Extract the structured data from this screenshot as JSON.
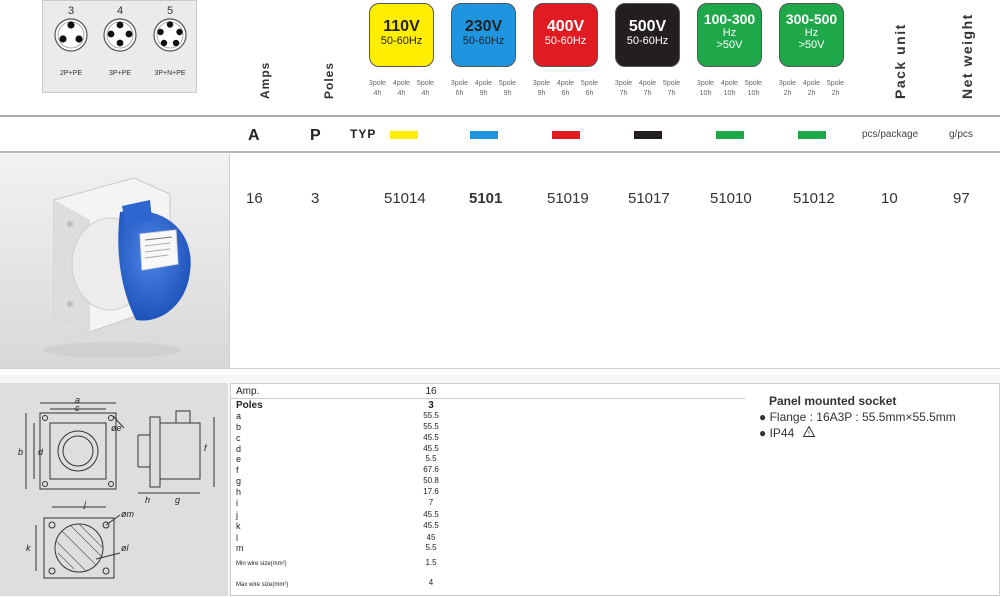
{
  "pin_configs": [
    {
      "number": "3",
      "label": "2P+PE",
      "pins": 3
    },
    {
      "number": "4",
      "label": "3P+PE",
      "pins": 4
    },
    {
      "number": "5",
      "label": "3P+N+PE",
      "pins": 5
    }
  ],
  "column_headers": {
    "amps": "Amps",
    "poles": "Poles",
    "pack_unit": "Pack unit",
    "net_weight": "Net weight"
  },
  "voltage_boxes": [
    {
      "voltage": "110V",
      "freq": "50-60Hz",
      "extra": "",
      "color": "#ffee00",
      "text_color": "#222222",
      "poles": [
        {
          "p": "3pole",
          "h": "4h"
        },
        {
          "p": "4pole",
          "h": "4h"
        },
        {
          "p": "5pole",
          "h": "4h"
        }
      ]
    },
    {
      "voltage": "230V",
      "freq": "50-60Hz",
      "extra": "",
      "color": "#1f95e0",
      "text_color": "#222222",
      "poles": [
        {
          "p": "3pole",
          "h": "6h"
        },
        {
          "p": "4pole",
          "h": "9h"
        },
        {
          "p": "5pole",
          "h": "9h"
        }
      ]
    },
    {
      "voltage": "400V",
      "freq": "50-60Hz",
      "extra": "",
      "color": "#e01b22",
      "text_color": "#ffffff",
      "poles": [
        {
          "p": "3pole",
          "h": "9h"
        },
        {
          "p": "4pole",
          "h": "6h"
        },
        {
          "p": "5pole",
          "h": "6h"
        }
      ]
    },
    {
      "voltage": "500V",
      "freq": "50-60Hz",
      "extra": "",
      "color": "#231f1f",
      "text_color": "#ffffff",
      "poles": [
        {
          "p": "3pole",
          "h": "7h"
        },
        {
          "p": "4pole",
          "h": "7h"
        },
        {
          "p": "5pole",
          "h": "7h"
        }
      ]
    },
    {
      "voltage": "100-300",
      "freq": "Hz",
      "extra": ">50V",
      "color": "#1ea84a",
      "text_color": "#ffffff",
      "poles": [
        {
          "p": "3pole",
          "h": "10h"
        },
        {
          "p": "4pole",
          "h": "10h"
        },
        {
          "p": "5pole",
          "h": "10h"
        }
      ]
    },
    {
      "voltage": "300-500",
      "freq": "Hz",
      "extra": ">50V",
      "color": "#1ea84a",
      "text_color": "#ffffff",
      "poles": [
        {
          "p": "3pole",
          "h": "2h"
        },
        {
          "p": "4pole",
          "h": "2h"
        },
        {
          "p": "5pole",
          "h": "2h"
        }
      ]
    }
  ],
  "type_row": {
    "amps_label": "A",
    "poles_label": "P",
    "typ_label": "TYP",
    "swatch_colors": [
      "#ffee00",
      "#1f95e0",
      "#e01b22",
      "#231f1f",
      "#1ea84a",
      "#1ea84a"
    ],
    "pack_unit": "pcs/package",
    "weight_unit": "g/pcs"
  },
  "product": {
    "amps": "16",
    "poles": "3",
    "codes": [
      "51014",
      "5101",
      "51019",
      "51017",
      "51010",
      "51012"
    ],
    "bold_index": 1,
    "pack": "10",
    "weight": "97"
  },
  "drawing_labels": {
    "a": "a",
    "b": "b",
    "c": "c",
    "d": "d",
    "e": "øe",
    "f": "f",
    "g": "g",
    "h": "h",
    "j": "j",
    "k": "k",
    "l": "øl",
    "m": "øm"
  },
  "spec": {
    "amp_label": "Amp.",
    "amp_value": "16",
    "poles_label": "Poles",
    "poles_value": "3",
    "dims": [
      {
        "k": "a",
        "v": "55.5"
      },
      {
        "k": "b",
        "v": "55.5"
      },
      {
        "k": "c",
        "v": "45.5"
      },
      {
        "k": "d",
        "v": "45.5"
      },
      {
        "k": "e",
        "v": "5.5"
      },
      {
        "k": "f",
        "v": "67.6"
      },
      {
        "k": "g",
        "v": "50.8"
      },
      {
        "k": "h",
        "v": "17.6"
      },
      {
        "k": "i",
        "v": "7"
      },
      {
        "k": "j",
        "v": "45.5"
      },
      {
        "k": "k",
        "v": "45.5"
      },
      {
        "k": "l",
        "v": "45"
      },
      {
        "k": "m",
        "v": "5.5"
      }
    ],
    "min_wire_label": "Min wire size(mm²)",
    "min_wire_value": "1.5",
    "max_wire_label": "Max wire size(mm²)",
    "max_wire_value": "4"
  },
  "description": {
    "title": "Panel mounted socket",
    "lines": [
      "● Flange : 16A3P : 55.5mm×55.5mm",
      "● IP44"
    ]
  }
}
